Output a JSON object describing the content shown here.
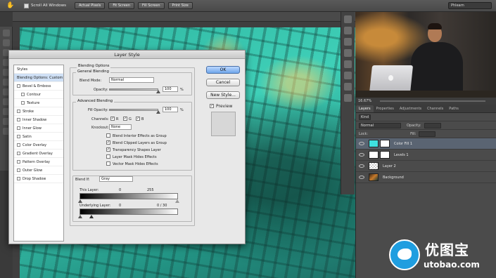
{
  "options_bar": {
    "scroll_all_label": "Scroll All Windows",
    "buttons": [
      "Actual Pixels",
      "Fit Screen",
      "Fill Screen",
      "Print Size"
    ],
    "workspace": "Phlearn"
  },
  "dialog": {
    "title": "Layer Style",
    "styles": [
      {
        "label": "Styles",
        "checkbox": false,
        "indent": false,
        "active": false
      },
      {
        "label": "Blending Options: Custom",
        "checkbox": false,
        "indent": false,
        "active": true
      },
      {
        "label": "Bevel & Emboss",
        "checkbox": true,
        "indent": false,
        "active": false
      },
      {
        "label": "Contour",
        "checkbox": true,
        "indent": true,
        "active": false
      },
      {
        "label": "Texture",
        "checkbox": true,
        "indent": true,
        "active": false
      },
      {
        "label": "Stroke",
        "checkbox": true,
        "indent": false,
        "active": false
      },
      {
        "label": "Inner Shadow",
        "checkbox": true,
        "indent": false,
        "active": false
      },
      {
        "label": "Inner Glow",
        "checkbox": true,
        "indent": false,
        "active": false
      },
      {
        "label": "Satin",
        "checkbox": true,
        "indent": false,
        "active": false
      },
      {
        "label": "Color Overlay",
        "checkbox": true,
        "indent": false,
        "active": false
      },
      {
        "label": "Gradient Overlay",
        "checkbox": true,
        "indent": false,
        "active": false
      },
      {
        "label": "Pattern Overlay",
        "checkbox": true,
        "indent": false,
        "active": false
      },
      {
        "label": "Outer Glow",
        "checkbox": true,
        "indent": false,
        "active": false
      },
      {
        "label": "Drop Shadow",
        "checkbox": true,
        "indent": false,
        "active": false
      }
    ],
    "blending_options_title": "Blending Options",
    "general_blending_title": "General Blending",
    "blend_mode_label": "Blend Mode:",
    "blend_mode_value": "Normal",
    "opacity_label": "Opacity:",
    "opacity_value": "100",
    "opacity_fill": 1.0,
    "percent": "%",
    "advanced_blending_title": "Advanced Blending",
    "fill_opacity_label": "Fill Opacity:",
    "fill_opacity_value": "100",
    "fill_opacity_fill": 1.0,
    "channels_label": "Channels:",
    "channels": [
      {
        "label": "R",
        "checked": true
      },
      {
        "label": "G",
        "checked": true
      },
      {
        "label": "B",
        "checked": true
      }
    ],
    "knockout_label": "Knockout:",
    "knockout_value": "None",
    "advanced_options": [
      {
        "label": "Blend Interior Effects as Group",
        "checked": false
      },
      {
        "label": "Blend Clipped Layers as Group",
        "checked": true
      },
      {
        "label": "Transparency Shapes Layer",
        "checked": true
      },
      {
        "label": "Layer Mask Hides Effects",
        "checked": false
      },
      {
        "label": "Vector Mask Hides Effects",
        "checked": false
      }
    ],
    "blend_if_label": "Blend If:",
    "blend_if_value": "Gray",
    "this_layer_label": "This Layer:",
    "this_layer_min": "0",
    "this_layer_max": "255",
    "underlying_label": "Underlying Layer:",
    "underlying_value": "0",
    "underlying_split": "0 / 30",
    "ok_label": "OK",
    "cancel_label": "Cancel",
    "new_style_label": "New Style...",
    "preview_label": "Preview",
    "preview_checked": true,
    "check_mark": "✓"
  },
  "panels": {
    "zoom": "16.67%",
    "tabs": [
      "Layers",
      "Properties",
      "Adjustments",
      "Channels",
      "Paths"
    ],
    "kind_label": "Kind",
    "blend_mode": "Normal",
    "opacity_label": "Opacity:",
    "lock_label": "Lock:",
    "fill_label": "Fill:",
    "layers": [
      {
        "name": "Color Fill 1",
        "active": true,
        "thumb": "cyan"
      },
      {
        "name": "Levels 1",
        "active": false,
        "thumb": "white"
      },
      {
        "name": "Layer 2",
        "active": false,
        "thumb": "checker"
      },
      {
        "name": "Background",
        "active": false,
        "thumb": "photo"
      }
    ]
  },
  "watermark": {
    "chinese": "优图宝",
    "site": "utobao.com"
  },
  "colors": {
    "canvas_teal": "#35c4ac",
    "selected_layer": "#5a6472",
    "ok_button": "#6fa6ea"
  }
}
